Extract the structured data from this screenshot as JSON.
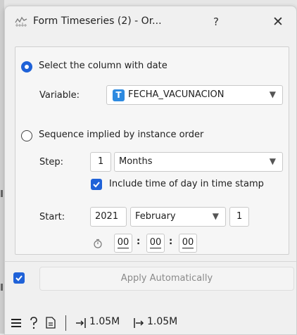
{
  "window": {
    "title": "Form Timeseries (2) - Or...",
    "help": "?",
    "close": "✕"
  },
  "date_column": {
    "label": "Select the column with date",
    "selected": true,
    "variable_label": "Variable:",
    "variable_type_badge": "T",
    "variable_value": "FECHA_VACUNACION"
  },
  "sequence": {
    "label": "Sequence implied by instance order",
    "selected": false,
    "step_label": "Step:",
    "step_value": "1",
    "step_unit": "Months",
    "include_time_label": "Include time of day in time stamp",
    "include_time_checked": true,
    "start_label": "Start:",
    "start_year": "2021",
    "start_month": "February",
    "start_day": "1",
    "time_hh": "00",
    "time_mm": "00",
    "time_ss": "00",
    "time_sep": ":"
  },
  "apply": {
    "label": "Apply Automatically",
    "checked": true
  },
  "status": {
    "input_count": "1.05M",
    "output_count": "1.05M"
  },
  "icons": [
    "menu-icon",
    "help-icon",
    "report-icon",
    "input-icon",
    "output-icon",
    "clock-icon"
  ]
}
